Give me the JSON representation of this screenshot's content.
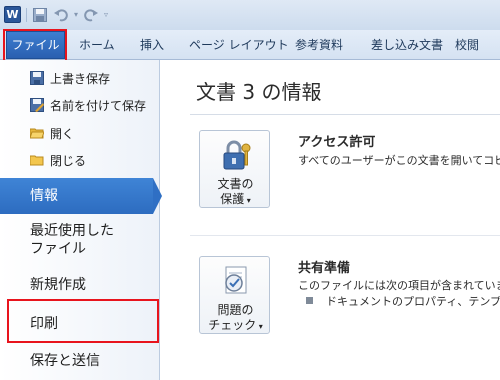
{
  "qat": {
    "app_icon_letter": "W",
    "icons": [
      "word-icon",
      "save-icon",
      "undo-icon",
      "redo-icon",
      "customize-icon"
    ]
  },
  "ribbon": {
    "file_tab": "ファイル",
    "tabs": [
      "ホーム",
      "挿入",
      "ページ レイアウト",
      "参考資料",
      "差し込み文書",
      "校閲"
    ]
  },
  "nav": {
    "commands": [
      "上書き保存",
      "名前を付けて保存",
      "開く",
      "閉じる"
    ],
    "selected": "情報",
    "recent_line1": "最近使用した",
    "recent_line2": "ファイル",
    "new": "新規作成",
    "print": "印刷",
    "save_send": "保存と送信"
  },
  "main": {
    "title": "文書 3 の情報",
    "permissions": {
      "button_line1": "文書の",
      "button_line2": "保護",
      "title": "アクセス許可",
      "desc": "すべてのユーザーがこの文書を開いてコピ"
    },
    "prepare": {
      "button_line1": "問題の",
      "button_line2": "チェック",
      "title": "共有準備",
      "desc": "このファイルには次の項目が含まれていま",
      "bullet": "ドキュメントのプロパティ、テンプレー"
    }
  },
  "colors": {
    "accent": "#2d6cc0",
    "highlight": "#e8141d",
    "ribbon_text": "#1e395b"
  }
}
